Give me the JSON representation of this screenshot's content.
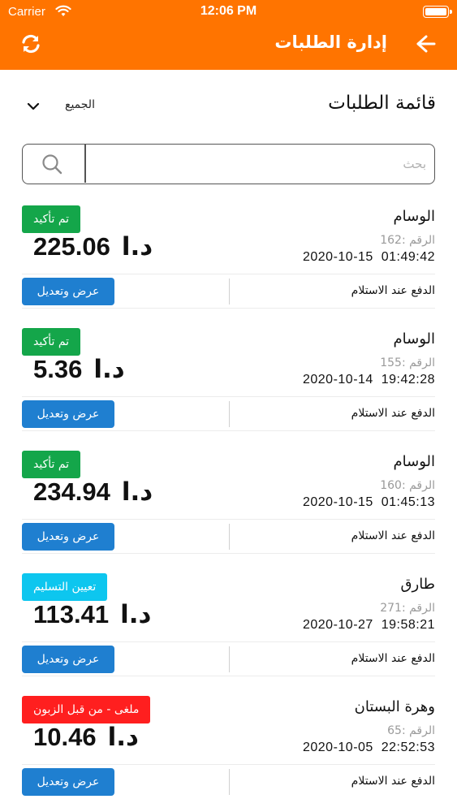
{
  "status_bar": {
    "carrier": "Carrier",
    "time": "12:06 PM"
  },
  "header": {
    "title": "إدارة الطلبات",
    "back_icon": "arrow-right-icon",
    "refresh_icon": "refresh-icon"
  },
  "list": {
    "title": "قائمة الطلبات",
    "filter_selected": "الجميع"
  },
  "search": {
    "placeholder": "بحث",
    "value": ""
  },
  "colors": {
    "header_bg": "#ff7400",
    "confirmed": "#14a64a",
    "assigned": "#0dc6ef",
    "cancelled": "#ff1f1f",
    "edit_button": "#1f7fd0"
  },
  "orders": [
    {
      "customer": "الوسام",
      "number_label": "الرقم :",
      "number": "162",
      "date": "2020-10-15",
      "time": "01:49:42",
      "status": "تم تأكيد",
      "status_color": "#14a64a",
      "amount": "225.06",
      "currency": "د.ا",
      "payment": "الدفع عند الاستلام",
      "action": "عرض وتعديل"
    },
    {
      "customer": "الوسام",
      "number_label": "الرقم :",
      "number": "155",
      "date": "2020-10-14",
      "time": "19:42:28",
      "status": "تم تأكيد",
      "status_color": "#14a64a",
      "amount": "5.36",
      "currency": "د.ا",
      "payment": "الدفع عند الاستلام",
      "action": "عرض وتعديل"
    },
    {
      "customer": "الوسام",
      "number_label": "الرقم :",
      "number": "160",
      "date": "2020-10-15",
      "time": "01:45:13",
      "status": "تم تأكيد",
      "status_color": "#14a64a",
      "amount": "234.94",
      "currency": "د.ا",
      "payment": "الدفع عند الاستلام",
      "action": "عرض وتعديل"
    },
    {
      "customer": "طارق",
      "number_label": "الرقم :",
      "number": "271",
      "date": "2020-10-27",
      "time": "19:58:21",
      "status": "تعيين التسليم",
      "status_color": "#0dc6ef",
      "amount": "113.41",
      "currency": "د.ا",
      "payment": "الدفع عند الاستلام",
      "action": "عرض وتعديل"
    },
    {
      "customer": "وهرة البستان",
      "number_label": "الرقم :",
      "number": "65",
      "date": "2020-10-05",
      "time": "22:52:53",
      "status": "ملغى - من قبل الزبون",
      "status_color": "#ff1f1f",
      "amount": "10.46",
      "currency": "د.ا",
      "payment": "الدفع عند الاستلام",
      "action": "عرض وتعديل"
    }
  ]
}
